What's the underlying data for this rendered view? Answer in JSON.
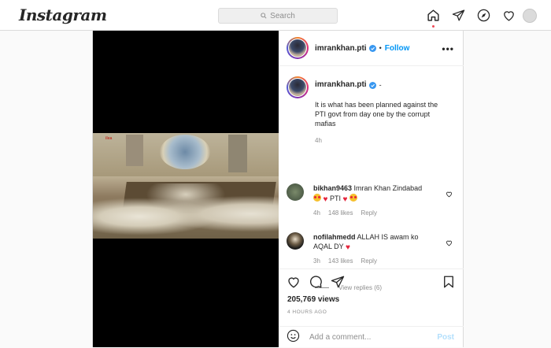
{
  "app": {
    "logo": "Instagram"
  },
  "search": {
    "placeholder": "Search"
  },
  "nav": {
    "icons": [
      "home-icon",
      "direct-icon",
      "explore-icon",
      "activity-icon",
      "profile-avatar"
    ],
    "active_dot_color": "#ed4956"
  },
  "post": {
    "username": "imrankhan.pti",
    "follow_label": "Follow",
    "separator": "•",
    "caption_suffix": "-",
    "caption": "It is what has been planned against the PTI govt from day one by the corrupt mafias",
    "caption_time": "4h",
    "comments": [
      {
        "user": "bikhan9463",
        "text": "Imran Khan Zindabad",
        "text2": "PTI",
        "time": "4h",
        "likes": "148 likes",
        "reply": "Reply"
      },
      {
        "user": "nofilahmedd",
        "text": "ALLAH IS awam ko AQAL DY",
        "time": "3h",
        "likes": "143 likes",
        "reply": "Reply"
      }
    ],
    "view_replies": "View replies (6)",
    "views": "205,769 views",
    "ago": "4 HOURS AGO",
    "add_comment_placeholder": "Add a comment...",
    "post_button": "Post",
    "video_tag": "ilea"
  },
  "colors": {
    "link": "#0095f6",
    "border": "#dbdbdb",
    "muted": "#8e8e8e",
    "heart": "#e5243b"
  }
}
